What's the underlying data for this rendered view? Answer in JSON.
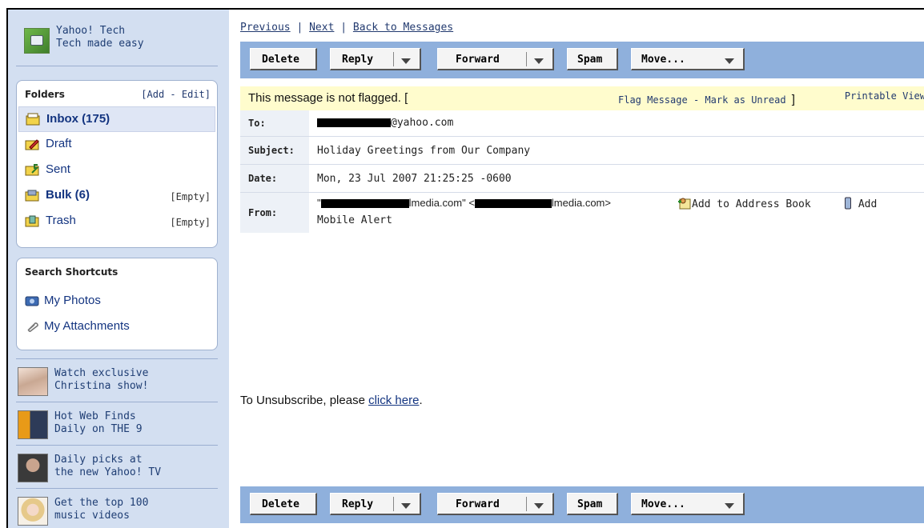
{
  "sidebar": {
    "promo_top": {
      "line1": "Yahoo! Tech",
      "line2": "Tech made easy"
    },
    "folders": {
      "title": "Folders",
      "add_edit": "[Add - Edit]",
      "items": [
        {
          "label": "Inbox (175)",
          "action": ""
        },
        {
          "label": "Draft",
          "action": ""
        },
        {
          "label": "Sent",
          "action": ""
        },
        {
          "label": "Bulk (6)",
          "action": "[Empty]"
        },
        {
          "label": "Trash",
          "action": "[Empty]"
        }
      ]
    },
    "shortcuts": {
      "title": "Search Shortcuts",
      "items": [
        {
          "label": "My Photos"
        },
        {
          "label": "My Attachments"
        }
      ]
    },
    "promos": [
      {
        "line1": "Watch exclusive",
        "line2": "Christina show!"
      },
      {
        "line1": "Hot Web Finds",
        "line2": "Daily on THE 9"
      },
      {
        "line1": "Daily picks at",
        "line2": "the new Yahoo! TV"
      },
      {
        "line1": "Get the top 100",
        "line2": "music videos"
      }
    ]
  },
  "nav": {
    "previous": "Previous",
    "next": "Next",
    "back": "Back to Messages",
    "sep": "|"
  },
  "toolbar": {
    "delete": "Delete",
    "reply": "Reply",
    "forward": "Forward",
    "spam": "Spam",
    "move": "Move..."
  },
  "flag": {
    "message": "This message is not flagged.",
    "open": "[",
    "flag_link": "Flag Message",
    "dash": "-",
    "unread_link": "Mark as Unread",
    "close": "]",
    "printable": "Printable View"
  },
  "header": {
    "to_label": "To:",
    "to_value": "@yahoo.com",
    "subject_label": "Subject:",
    "subject_value": "Holiday Greetings from Our Company",
    "date_label": "Date:",
    "date_value": "Mon, 23 Jul 2007 21:25:25 -0600",
    "from_label": "From:",
    "from_q1": "\"",
    "from_mid1": "lmedia.com\" <",
    "from_mid2": "lmedia.com>",
    "add_address": "Add to Address Book",
    "add_mobile_1": "Add",
    "add_mobile_2": "Mobile Alert"
  },
  "body": {
    "text": "To Unsubscribe, please ",
    "link": "click here",
    "end": "."
  },
  "colors": {
    "sidebar_bg": "#d3dff1",
    "toolbar_bg": "#8fb0dc",
    "flag_bg": "#fffccd",
    "link": "#223a6f"
  }
}
